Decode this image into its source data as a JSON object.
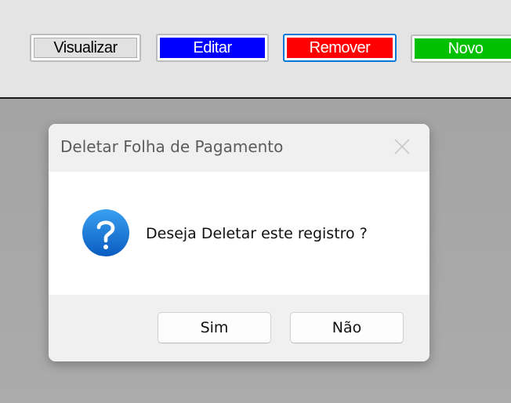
{
  "toolbar": {
    "visualizar_label": "Visualizar",
    "editar_label": "Editar",
    "remover_label": "Remover",
    "novo_label": "Novo"
  },
  "dialog": {
    "title": "Deletar Folha de Pagamento",
    "message": "Deseja Deletar este registro ?",
    "yes_label": "Sim",
    "no_label": "Não",
    "icon": "question-icon"
  },
  "colors": {
    "editar": "#0000ff",
    "remover": "#ff0000",
    "novo": "#00c000",
    "focus_border": "#0078d7"
  }
}
